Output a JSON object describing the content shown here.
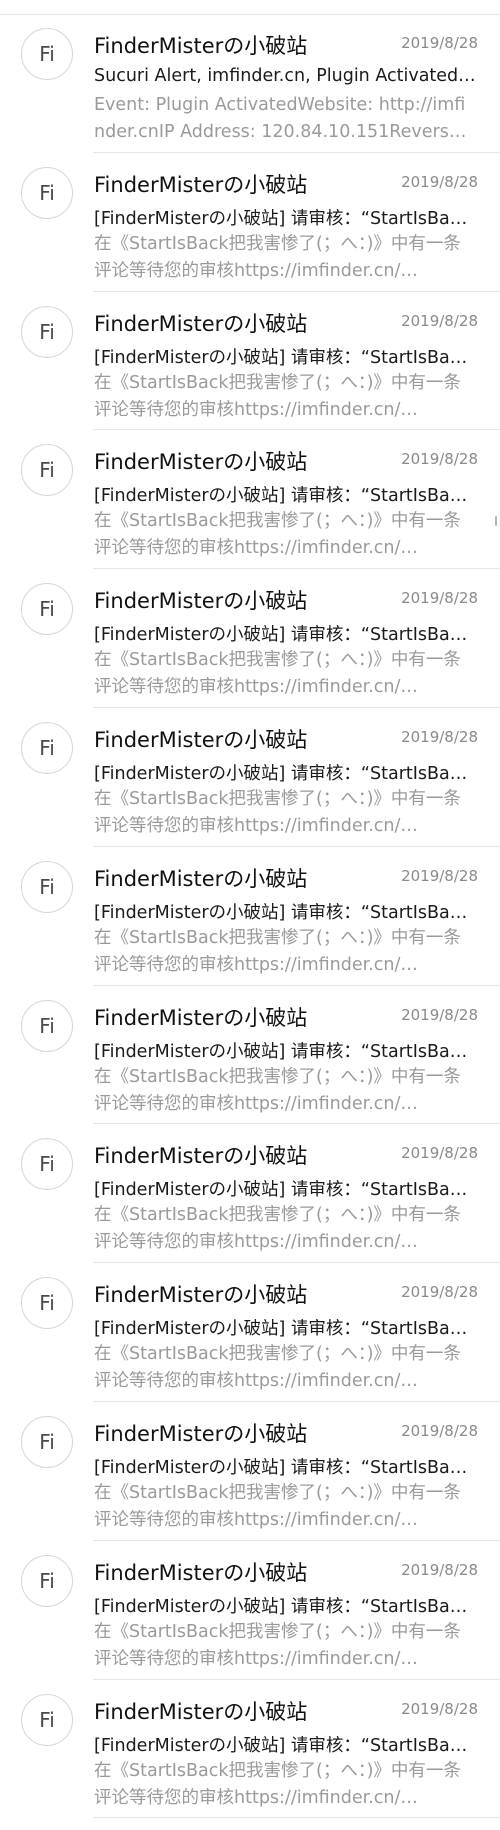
{
  "emails": [
    {
      "avatar": "Fi",
      "sender": "FinderMisterの小破站",
      "date": "2019/8/28",
      "subject": "Sucuri Alert, imfinder.cn, Plugin Activated, …",
      "preview": "Event: Plugin ActivatedWebsite: http://imfinder.cnIP Address: 120.84.10.151Reverse …"
    },
    {
      "avatar": "Fi",
      "sender": "FinderMisterの小破站",
      "date": "2019/8/28",
      "subject": "[FinderMisterの小破站] 请审核：“StartIsBa…",
      "preview": "在《StartIsBack把我害惨了(；へ：)》中有一条评论等待您的审核https://imfinder.cn/…"
    },
    {
      "avatar": "Fi",
      "sender": "FinderMisterの小破站",
      "date": "2019/8/28",
      "subject": "[FinderMisterの小破站] 请审核：“StartIsBa…",
      "preview": "在《StartIsBack把我害惨了(；へ：)》中有一条评论等待您的审核https://imfinder.cn/…"
    },
    {
      "avatar": "Fi",
      "sender": "FinderMisterの小破站",
      "date": "2019/8/28",
      "subject": "[FinderMisterの小破站] 请审核：“StartIsBa…",
      "preview": "在《StartIsBack把我害惨了(；へ：)》中有一条评论等待您的审核https://imfinder.cn/…"
    },
    {
      "avatar": "Fi",
      "sender": "FinderMisterの小破站",
      "date": "2019/8/28",
      "subject": "[FinderMisterの小破站] 请审核：“StartIsBa…",
      "preview": "在《StartIsBack把我害惨了(；へ：)》中有一条评论等待您的审核https://imfinder.cn/…"
    },
    {
      "avatar": "Fi",
      "sender": "FinderMisterの小破站",
      "date": "2019/8/28",
      "subject": "[FinderMisterの小破站] 请审核：“StartIsBa…",
      "preview": "在《StartIsBack把我害惨了(；へ：)》中有一条评论等待您的审核https://imfinder.cn/…"
    },
    {
      "avatar": "Fi",
      "sender": "FinderMisterの小破站",
      "date": "2019/8/28",
      "subject": "[FinderMisterの小破站] 请审核：“StartIsBa…",
      "preview": "在《StartIsBack把我害惨了(；へ：)》中有一条评论等待您的审核https://imfinder.cn/…"
    },
    {
      "avatar": "Fi",
      "sender": "FinderMisterの小破站",
      "date": "2019/8/28",
      "subject": "[FinderMisterの小破站] 请审核：“StartIsBa…",
      "preview": "在《StartIsBack把我害惨了(；へ：)》中有一条评论等待您的审核https://imfinder.cn/…"
    },
    {
      "avatar": "Fi",
      "sender": "FinderMisterの小破站",
      "date": "2019/8/28",
      "subject": "[FinderMisterの小破站] 请审核：“StartIsBa…",
      "preview": "在《StartIsBack把我害惨了(；へ：)》中有一条评论等待您的审核https://imfinder.cn/…"
    },
    {
      "avatar": "Fi",
      "sender": "FinderMisterの小破站",
      "date": "2019/8/28",
      "subject": "[FinderMisterの小破站] 请审核：“StartIsBa…",
      "preview": "在《StartIsBack把我害惨了(；へ：)》中有一条评论等待您的审核https://imfinder.cn/…"
    },
    {
      "avatar": "Fi",
      "sender": "FinderMisterの小破站",
      "date": "2019/8/28",
      "subject": "[FinderMisterの小破站] 请审核：“StartIsBa…",
      "preview": "在《StartIsBack把我害惨了(；へ：)》中有一条评论等待您的审核https://imfinder.cn/…"
    },
    {
      "avatar": "Fi",
      "sender": "FinderMisterの小破站",
      "date": "2019/8/28",
      "subject": "[FinderMisterの小破站] 请审核：“StartIsBa…",
      "preview": "在《StartIsBack把我害惨了(；へ：)》中有一条评论等待您的审核https://imfinder.cn/…"
    },
    {
      "avatar": "Fi",
      "sender": "FinderMisterの小破站",
      "date": "2019/8/28",
      "subject": "[FinderMisterの小破站] 请审核：“StartIsBa…",
      "preview": "在《StartIsBack把我害惨了(；へ：)》中有一条评论等待您的审核https://imfinder.cn/…"
    }
  ]
}
